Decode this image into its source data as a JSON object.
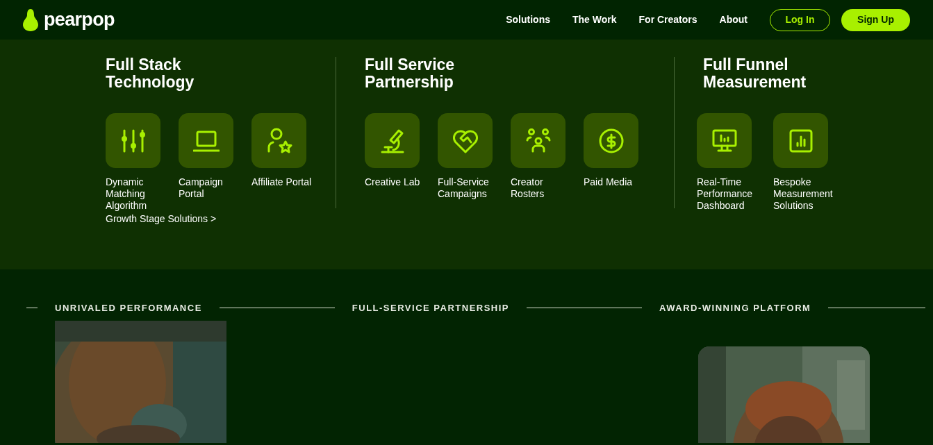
{
  "brand": "pearpop",
  "nav": [
    {
      "label": "Solutions"
    },
    {
      "label": "The Work"
    },
    {
      "label": "For Creators"
    },
    {
      "label": "About"
    }
  ],
  "log_in": "Log In",
  "sign_up": "Sign Up",
  "menu": {
    "columns": [
      {
        "title": "Full Stack Technology",
        "items": [
          {
            "label": "Dynamic Matching Algorithm"
          },
          {
            "label": "Campaign Portal"
          },
          {
            "label": "Affiliate Portal"
          }
        ]
      },
      {
        "title": "Full Service Partnership",
        "items": [
          {
            "label": "Creative Lab"
          },
          {
            "label": "Full-Service Campaigns"
          },
          {
            "label": "Creator Rosters"
          },
          {
            "label": "Paid Media"
          }
        ]
      },
      {
        "title": "Full Funnel Measurement",
        "items": [
          {
            "label": "Real-Time Performance Dashboard"
          },
          {
            "label": "Bespoke Measurement Solutions"
          }
        ]
      }
    ],
    "link": "Growth Stage Solutions >"
  },
  "sections": [
    {
      "label": "UNRIVALED PERFORMANCE"
    },
    {
      "label": "FULL-SERVICE PARTNERSHIP"
    },
    {
      "label": "AWARD-WINNING PLATFORM"
    }
  ]
}
